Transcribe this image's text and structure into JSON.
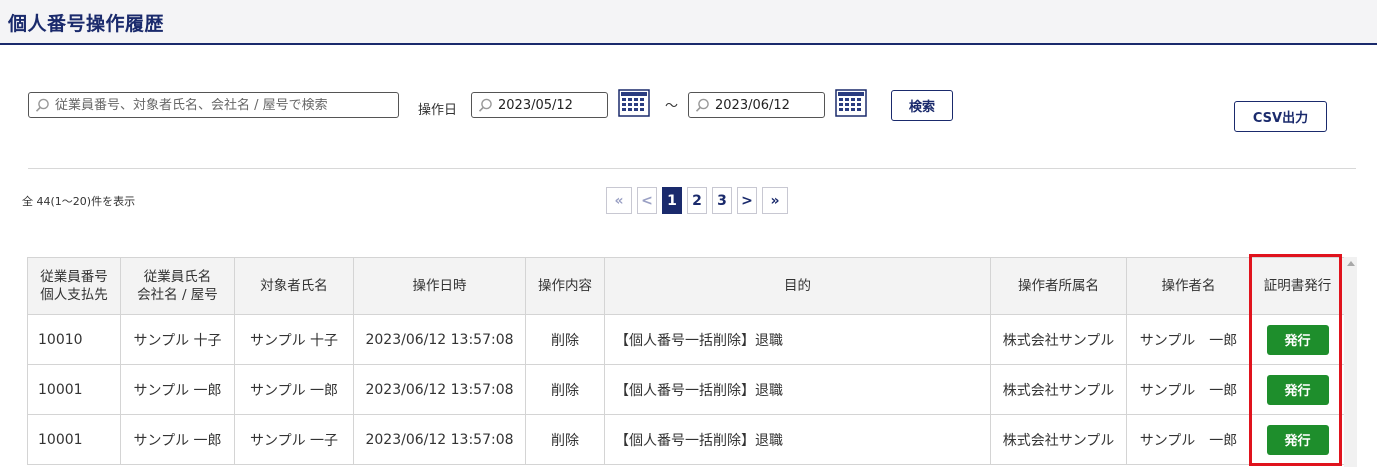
{
  "header": {
    "title": "個人番号操作履歴"
  },
  "filters": {
    "keyword": {
      "placeholder": "従業員番号、対象者氏名、会社名 / 屋号で検索",
      "value": ""
    },
    "date_label": "操作日",
    "date_from": "2023/05/12",
    "range_separator": "～",
    "date_to": "2023/06/12",
    "search_label": "検索",
    "csv_label": "CSV出力"
  },
  "results": {
    "count_text": "全 44(1～20)件を表示"
  },
  "pagination": {
    "first": "«",
    "prev": "<",
    "pages": [
      "1",
      "2",
      "3"
    ],
    "current": "1",
    "next": ">",
    "last": "»"
  },
  "table": {
    "headers": {
      "emp_no_1": "従業員番号",
      "emp_no_2": "個人支払先",
      "emp_name_1": "従業員氏名",
      "emp_name_2": "会社名 / 屋号",
      "target": "対象者氏名",
      "datetime": "操作日時",
      "op": "操作内容",
      "purpose": "目的",
      "org": "操作者所属名",
      "operator": "操作者名",
      "cert": "証明書発行"
    },
    "rows": [
      {
        "emp_no": "10010",
        "emp_name": "サンプル 十子",
        "target": "サンプル 十子",
        "datetime": "2023/06/12 13:57:08",
        "op": "削除",
        "purpose": "【個人番号一括削除】退職",
        "org": "株式会社サンプル",
        "operator": "サンプル　一郎",
        "cert_label": "発行"
      },
      {
        "emp_no": "10001",
        "emp_name": "サンプル 一郎",
        "target": "サンプル 一郎",
        "datetime": "2023/06/12 13:57:08",
        "op": "削除",
        "purpose": "【個人番号一括削除】退職",
        "org": "株式会社サンプル",
        "operator": "サンプル　一郎",
        "cert_label": "発行"
      },
      {
        "emp_no": "10001",
        "emp_name": "サンプル 一郎",
        "target": "サンプル 一子",
        "datetime": "2023/06/12 13:57:08",
        "op": "削除",
        "purpose": "【個人番号一括削除】退職",
        "org": "株式会社サンプル",
        "operator": "サンプル　一郎",
        "cert_label": "発行"
      }
    ]
  },
  "colors": {
    "brand": "#1a2a6c",
    "issue_button": "#1e8e2c",
    "highlight": "#e0131d"
  },
  "icons": {
    "search": "magnifier-icon",
    "calendar": "calendar-icon"
  }
}
